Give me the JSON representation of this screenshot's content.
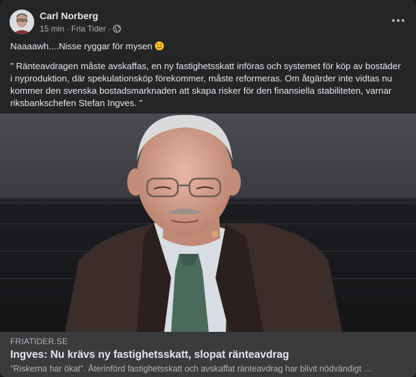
{
  "post": {
    "author": "Carl Norberg",
    "time": "15 min",
    "separator": "·",
    "source": "Fria Tider",
    "audience_icon": "globe-icon",
    "more_icon": "more-options-icon",
    "text_line1": "Naaaawh....Nisse ryggar för mysen",
    "emoji": "winking-face-emoji",
    "quote": "\" Ränteavdragen måste avskaffas, en ny fastighetsskatt införas och systemet för köp av bostäder i nyproduktion, där spekulationsköp förekommer, måste reformeras. Om åtgärder inte vidtas nu kommer den svenska bostadsmarknaden att skapa risker för den finansiella stabiliteten, varnar riksbankschefen Stefan Ingves. \""
  },
  "link": {
    "domain": "FRIATIDER.SE",
    "title": "Ingves: Nu krävs ny fastighetsskatt, slopat ränteavdrag",
    "description": "\"Riskerna har ökat\". Återinförd fastighetsskatt och avskaffat ränteavdrag har blivit nödvändigt …"
  },
  "colors": {
    "card": "#242526",
    "preview": "#3a3b3c",
    "text": "#e4e6eb",
    "secondary": "#b0b3b8"
  }
}
